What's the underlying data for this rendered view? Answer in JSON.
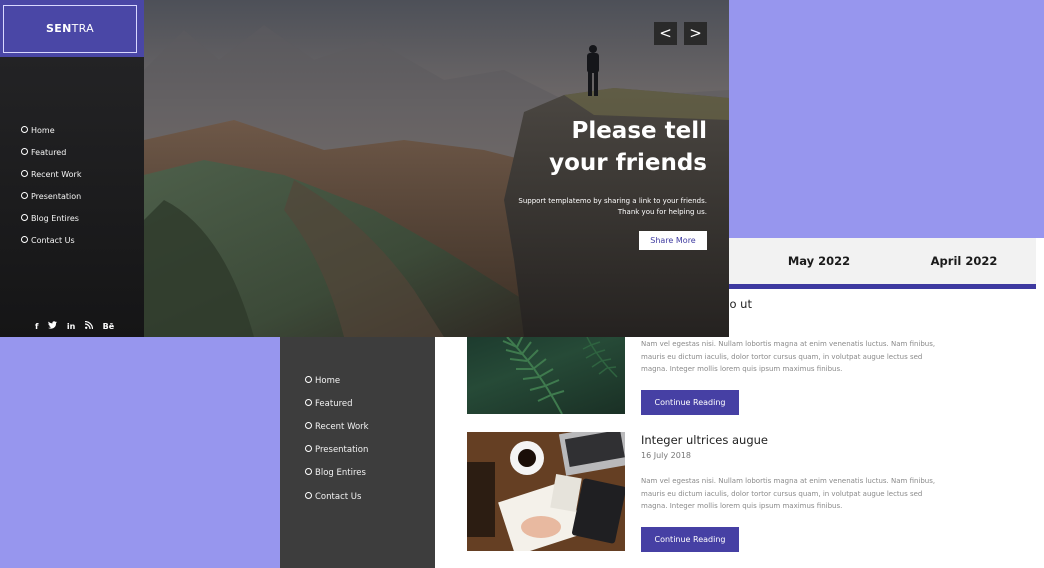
{
  "hero": {
    "logo_bold": "SEN",
    "logo_rest": "TRA",
    "nav": [
      "Home",
      "Featured",
      "Recent Work",
      "Presentation",
      "Blog Entires",
      "Contact Us"
    ],
    "social": [
      "f",
      "t",
      "in",
      "rss",
      "Bē"
    ],
    "prev_label": "<",
    "next_label": ">",
    "heading_line1": "Please tell",
    "heading_line2": "your friends",
    "sub_line1": "Support templatemo by sharing a link to your friends.",
    "sub_line2": "Thank you for helping us.",
    "share_label": "Share More"
  },
  "blog": {
    "tabs": [
      "May 2022",
      "April 2022"
    ],
    "nav": [
      "Home",
      "Featured",
      "Recent Work",
      "Presentation",
      "Blog Entires",
      "Contact Us"
    ],
    "posts": [
      {
        "title": "dio ut",
        "date": "",
        "excerpt": "Nam vel egestas nisi. Nullam lobortis magna at enim venenatis luctus. Nam finibus, mauris eu dictum iaculis, dolor tortor cursus quam, in volutpat augue lectus sed magna. Integer mollis lorem quis ipsum maximus finibus.",
        "button": "Continue Reading"
      },
      {
        "title": "Integer ultrices augue",
        "date": "16 July 2018",
        "excerpt": "Nam vel egestas nisi. Nullam lobortis magna at enim venenatis luctus. Nam finibus, mauris eu dictum iaculis, dolor tortor cursus quam, in volutpat augue lectus sed magna. Integer mollis lorem quis ipsum maximus finibus.",
        "button": "Continue Reading"
      }
    ]
  },
  "colors": {
    "background": "#9796ee",
    "accent": "#4640a4",
    "dark_sidebar": "#3d3d3d"
  }
}
